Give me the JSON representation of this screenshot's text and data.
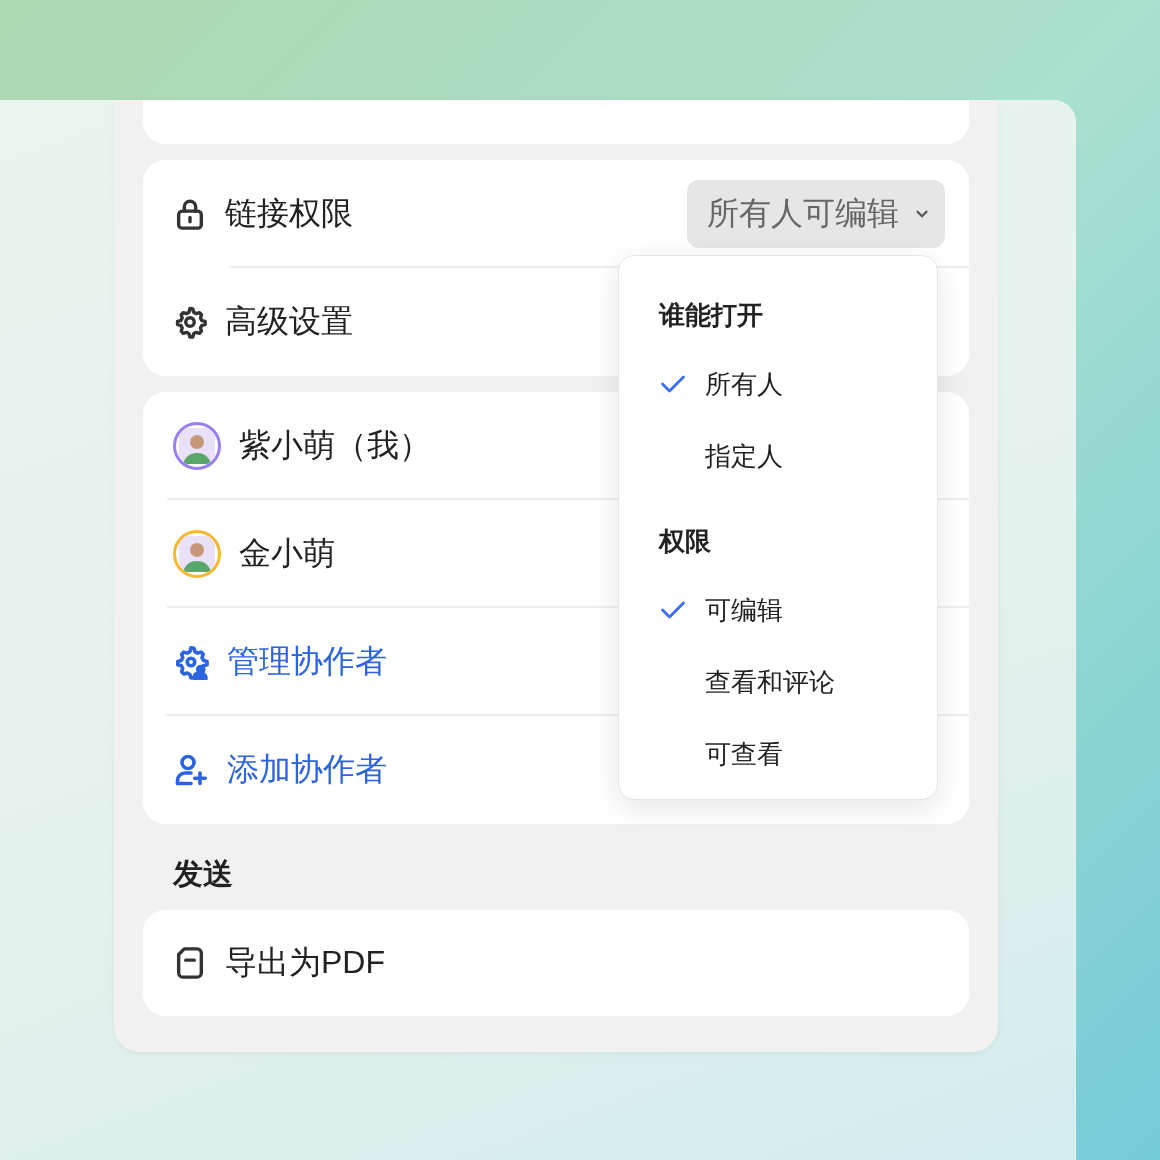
{
  "link_card": {
    "rows": [
      {
        "kind": "permission",
        "label": "链接权限",
        "value": "所有人可编辑"
      },
      {
        "kind": "settings",
        "label": "高级设置"
      }
    ]
  },
  "collaborators": [
    {
      "name": "紫小萌（我）",
      "color": "#9b7ef0"
    },
    {
      "name": "金小萌",
      "color": "#f7b733"
    }
  ],
  "actions": [
    {
      "kind": "manage",
      "label": "管理协作者"
    },
    {
      "kind": "add",
      "label": "添加协作者"
    }
  ],
  "send": {
    "heading": "发送",
    "items": [
      {
        "kind": "pdf",
        "label": "导出为PDF"
      }
    ]
  },
  "dropdown": {
    "sections": [
      {
        "title": "谁能打开",
        "options": [
          {
            "label": "所有人",
            "selected": true
          },
          {
            "label": "指定人",
            "selected": false
          }
        ]
      },
      {
        "title": "权限",
        "options": [
          {
            "label": "可编辑",
            "selected": true
          },
          {
            "label": "查看和评论",
            "selected": false
          },
          {
            "label": "可查看",
            "selected": false
          }
        ]
      }
    ]
  }
}
